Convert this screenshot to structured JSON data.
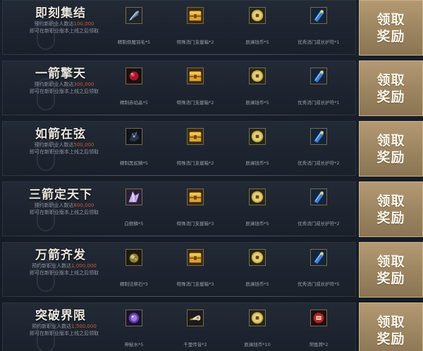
{
  "tiers": [
    {
      "title": "即刻集结",
      "desc_prefix": "预约新职业人数达",
      "desc_num": "100,000",
      "desc_line2": "即可在新职业版本上线之后领取",
      "claim_label": "领取奖励",
      "items": [
        {
          "icon": "feather-icon",
          "label": "精制烦魔羽毛*5"
        },
        {
          "icon": "treasure-chest-icon",
          "label": "特殊消门支援箱*2"
        },
        {
          "icon": "coin-icon",
          "label": "辰澜钱币*5"
        },
        {
          "icon": "talisman-icon",
          "label": "优秀消门成长护符*1"
        }
      ]
    },
    {
      "title": "一箭擎天",
      "desc_prefix": "预约新职业人数达",
      "desc_num": "300,000",
      "desc_line2": "即可在新职业版本上线之后领取",
      "claim_label": "领取奖励",
      "items": [
        {
          "icon": "red-gem-icon",
          "label": "精制赤焰晶*5"
        },
        {
          "icon": "treasure-chest-icon",
          "label": "特殊消门支援箱*2"
        },
        {
          "icon": "coin-icon",
          "label": "辰澜钱币*5"
        },
        {
          "icon": "talisman-icon",
          "label": "优秀消门成长护符*1"
        }
      ]
    },
    {
      "title": "如箭在弦",
      "desc_prefix": "预约新职业人数达",
      "desc_num": "500,000",
      "desc_line2": "即可在新职业版本上线之后领取",
      "claim_label": "领取奖励",
      "items": [
        {
          "icon": "dark-ore-icon",
          "label": "精制黑蛇鳞*5"
        },
        {
          "icon": "treasure-chest-icon",
          "label": "特殊消门支援箱*2"
        },
        {
          "icon": "coin-icon",
          "label": "辰澜钱币*5"
        },
        {
          "icon": "talisman-icon",
          "label": "优秀消门成长护符*2"
        }
      ]
    },
    {
      "title": "三箭定天下",
      "desc_prefix": "预约新职业人数达",
      "desc_num": "800,000",
      "desc_line2": "即可在新职业版本上线之后领取",
      "claim_label": "领取奖励",
      "items": [
        {
          "icon": "crystal-shard-icon",
          "label": "白鲵鳞*5"
        },
        {
          "icon": "treasure-chest-icon",
          "label": "特殊消门支援箱*3"
        },
        {
          "icon": "coin-icon",
          "label": "辰澜钱币*5"
        },
        {
          "icon": "talisman-icon",
          "label": "优秀消门成长护符*2"
        }
      ]
    },
    {
      "title": "万箭齐发",
      "desc_prefix": "预约新职业人数达",
      "desc_num": "1,000,000",
      "desc_line2": "即可在新职业版本上线之后领取",
      "claim_label": "领取奖励",
      "items": [
        {
          "icon": "magic-stone-icon",
          "label": "精制法祭石*3"
        },
        {
          "icon": "treasure-chest-icon",
          "label": "特殊消门支援箱*3"
        },
        {
          "icon": "coin-icon",
          "label": "辰澜钱币*5"
        },
        {
          "icon": "talisman-icon",
          "label": "优秀消门成长护符*5"
        }
      ]
    },
    {
      "title": "突破界限",
      "desc_prefix": "预约新职业人数达",
      "desc_num": "1,500,000",
      "desc_line2": "即可在新职业版本上线之后领取",
      "claim_label": "领取奖励",
      "items": [
        {
          "icon": "mystic-water-icon",
          "label": "神秘水*5"
        },
        {
          "icon": "horn-icon",
          "label": "千里传音*2"
        },
        {
          "icon": "coin-icon",
          "label": "辰澜钱币*10"
        },
        {
          "icon": "brand-token-icon",
          "label": "常胜牌*2"
        }
      ]
    }
  ],
  "colors": {
    "accent_number": "#c9573a",
    "claim_button": "#a68d67",
    "icon_border": "#7a6a45"
  }
}
